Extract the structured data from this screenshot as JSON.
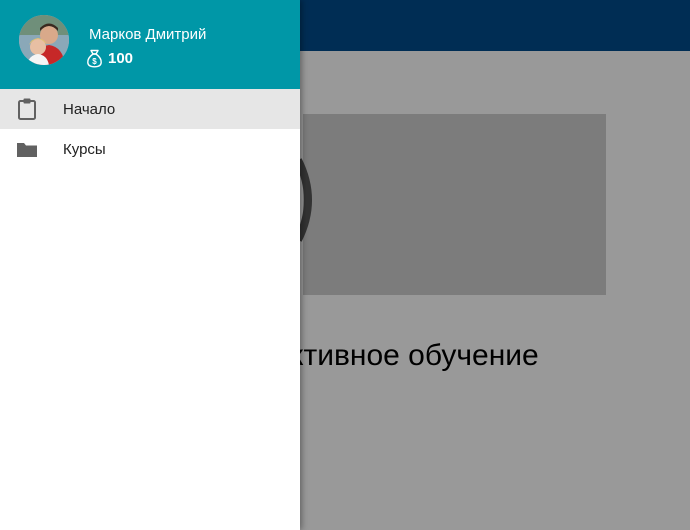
{
  "user": {
    "name": "Марков Дмитрий",
    "balance": "100"
  },
  "nav": {
    "items": [
      {
        "label": "Начало",
        "icon": "clipboard-icon",
        "active": true
      },
      {
        "label": "Курсы",
        "icon": "folder-icon",
        "active": false
      }
    ]
  },
  "background": {
    "hero_title": "Активное обучение"
  },
  "colors": {
    "header": "#0097a7",
    "app_bar": "#004c8c",
    "active_item": "#e6e6e6"
  }
}
